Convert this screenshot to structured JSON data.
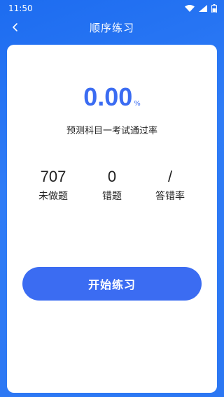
{
  "status": {
    "time": "11:50"
  },
  "header": {
    "title": "顺序练习"
  },
  "rate": {
    "value": "0.00",
    "unit": "%",
    "label": "预测科目一考试通过率"
  },
  "stats": [
    {
      "value": "707",
      "label": "未做题"
    },
    {
      "value": "0",
      "label": "错题"
    },
    {
      "value": "/",
      "label": "答错率"
    }
  ],
  "actions": {
    "start_label": "开始练习"
  },
  "colors": {
    "accent": "#3b6cf2",
    "background": "#2c77f3"
  }
}
